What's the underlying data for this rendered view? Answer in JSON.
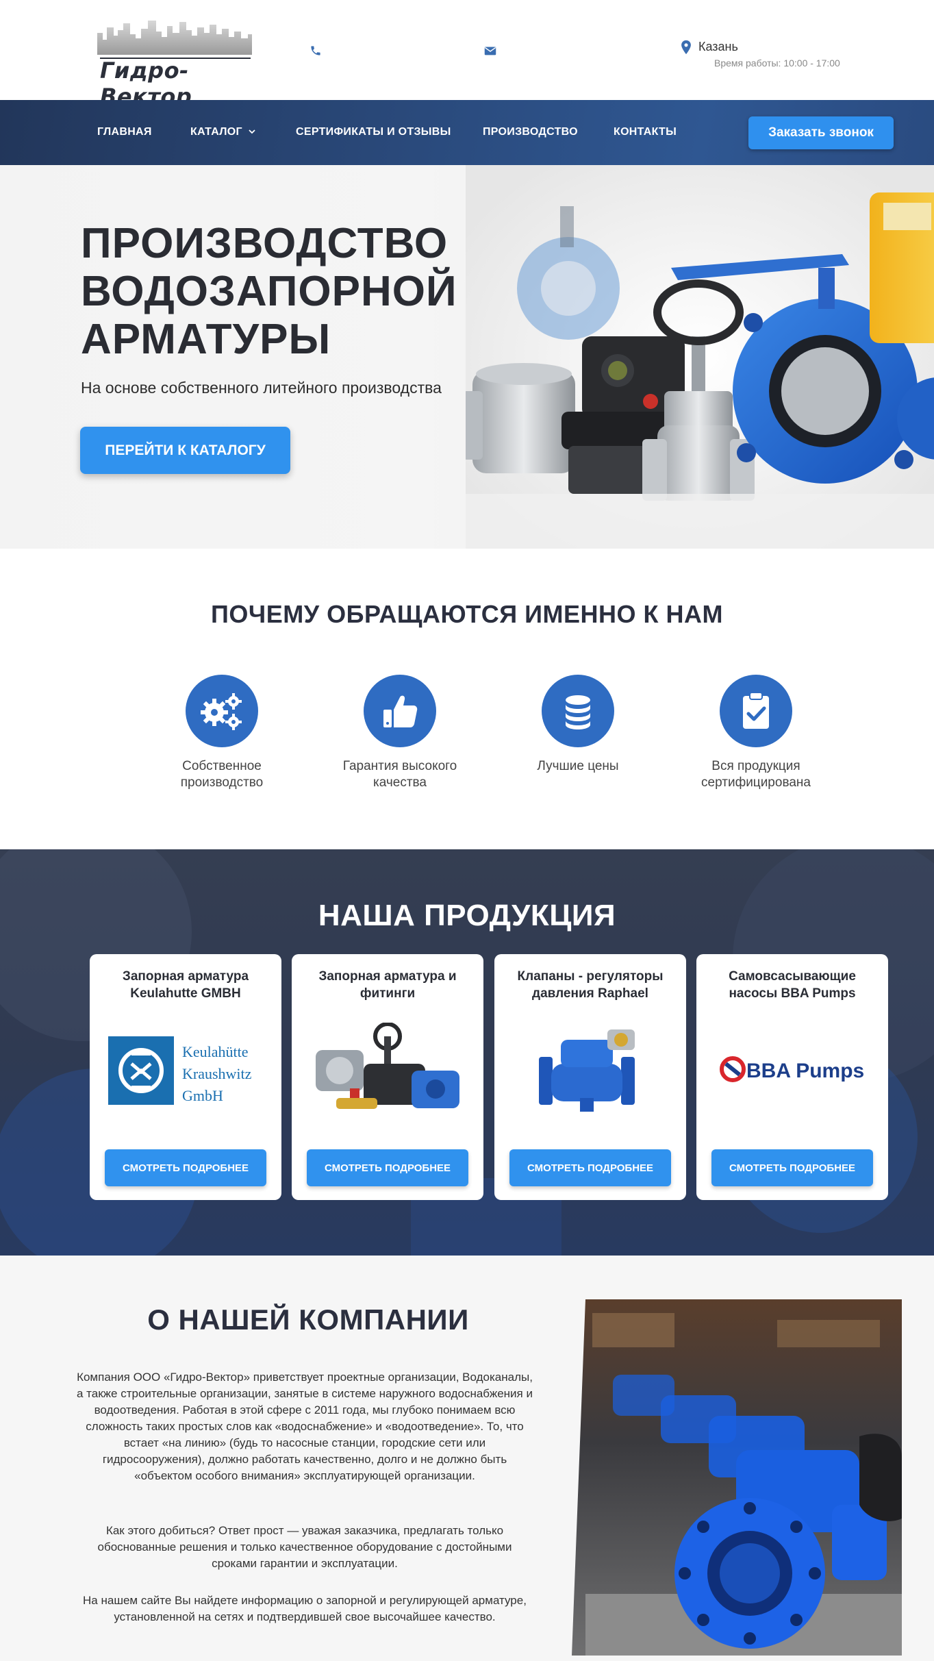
{
  "header": {
    "logo_text": "Гидро-Вектор",
    "city": "Казань",
    "hours": "Время работы: 10:00 - 17:00",
    "icons": [
      "phone-icon",
      "mail-icon",
      "map-pin-icon"
    ]
  },
  "nav": {
    "items": [
      "ГЛАВНАЯ",
      "КАТАЛОГ",
      "СЕРТИФИКАТЫ И ОТЗЫВЫ",
      "ПРОИЗВОДСТВО",
      "КОНТАКТЫ"
    ],
    "call_button": "Заказать звонок"
  },
  "hero": {
    "title_line1": "ПРОИЗВОДСТВО",
    "title_line2": "ВОДОЗАПОРНОЙ",
    "title_line3": "АРМАТУРЫ",
    "subtitle": "На основе собственного литейного производства",
    "button": "ПЕРЕЙТИ К КАТАЛОГУ"
  },
  "why": {
    "title": "ПОЧЕМУ ОБРАЩАЮТСЯ ИМЕННО К НАМ",
    "features": [
      {
        "line1": "Собственное",
        "line2": "производство",
        "icon": "gears-icon"
      },
      {
        "line1": "Гарантия высокого",
        "line2": "качества",
        "icon": "thumbs-up-icon"
      },
      {
        "line1": "Лучшие цены",
        "line2": "",
        "icon": "coins-icon"
      },
      {
        "line1": "Вся продукция",
        "line2": "сертифицирована",
        "icon": "clipboard-check-icon"
      }
    ]
  },
  "products": {
    "title": "НАША ПРОДУКЦИЯ",
    "cards": [
      {
        "line1": "Запорная арматура",
        "line2": "Keulahutte GMBH",
        "button": "СМОТРЕТЬ ПОДРОБНЕЕ",
        "logo_lines": [
          "Keulahütte",
          "Kraushwitz",
          "GmbH"
        ]
      },
      {
        "line1": "Запорная арматура и",
        "line2": "фитинги",
        "button": "СМОТРЕТЬ ПОДРОБНЕЕ"
      },
      {
        "line1": "Клапаны - регуляторы",
        "line2": "давления Raphael",
        "button": "СМОТРЕТЬ ПОДРОБНЕЕ"
      },
      {
        "line1": "Самовсасывающие",
        "line2": "насосы BBA Pumps",
        "button": "СМОТРЕТЬ ПОДРОБНЕЕ",
        "logo_text": "BBA Pumps"
      }
    ]
  },
  "about": {
    "title": "О НАШЕЙ КОМПАНИИ",
    "p1": "Компания ООО «Гидро-Вектор» приветствует проектные организации, Водоканалы, а также строительные организации, занятые в системе наружного водоснабжения и водоотведения. Работая в этой сфере с 2011 года, мы глубоко понимаем всю сложность таких простых слов как «водоснабжение» и «водоотведение». То, что встает «на линию» (будь то насосные станции, городские сети или гидросооружения), должно работать качественно, долго и не должно быть «объектом особого внимания» эксплуатирующей организации.",
    "p2": "Как этого добиться? Ответ прост — уважая заказчика, предлагать только обоснованные решения и только качественное оборудование с достойными сроками гарантии и эксплуатации.",
    "p3": "На нашем сайте Вы найдете информацию о запорной и регулирующей арматуре, установленной на сетях и подтвердившей свое высочайшее качество."
  },
  "colors": {
    "accent": "#3092ee",
    "nav_dark": "#22365a",
    "icon_blue": "#2f6cc2",
    "heading": "#2b2f3f"
  }
}
